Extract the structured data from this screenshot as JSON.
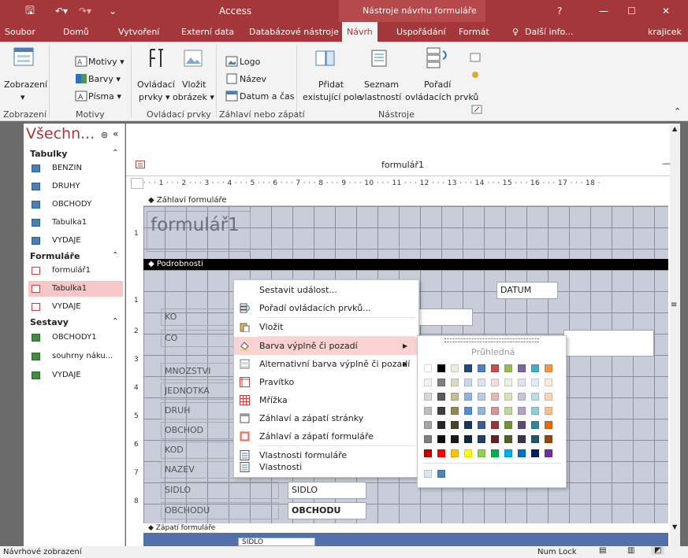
{
  "app": {
    "title": "Access",
    "context_title": "Nástroje návrhu formuláře",
    "help": "?",
    "minimize": "—",
    "maximize": "☐",
    "close": "✕"
  },
  "menu": {
    "tabs": [
      "Soubor",
      "Domů",
      "Vytvoření",
      "Externí data",
      "Databázové nástroje",
      "Návrh",
      "Uspořádání",
      "Formát"
    ],
    "tell_me": "Další info...",
    "user": "krajicek"
  },
  "ribbon": {
    "zobrazeni": "Zobrazení",
    "motivy": "Motivy",
    "barvy": "Barvy",
    "pisma": "Písma",
    "ovladaci": "Ovládací",
    "prvky": "prvky",
    "vlozit": "Vložit",
    "obrazek": "obrázek",
    "logo": "Logo",
    "nazev": "Název",
    "datum_cas": "Datum a čas",
    "pridat": "Přidat",
    "existujici_pole": "existující pole",
    "seznam": "Seznam",
    "vlastnosti": "vlastností",
    "poradi": "Pořadí",
    "ovladacich_prvku": "ovládacích prvků",
    "groups": {
      "zobrazeni": "Zobrazení",
      "motivy": "Motivy",
      "ovladaci_prvky": "Ovládací prvky",
      "zahlavi": "Záhlaví nebo zápatí",
      "nastroje": "Nástroje"
    }
  },
  "nav": {
    "title": "Všechn...",
    "groups": [
      {
        "name": "Tabulky",
        "items": [
          "BENZIN",
          "DRUHY",
          "OBCHODY",
          "Tabulka1",
          "VYDAJE"
        ]
      },
      {
        "name": "Formuláře",
        "items": [
          "formulář1",
          "Tabulka1",
          "VYDAJE"
        ]
      },
      {
        "name": "Sestavy",
        "items": [
          "OBCHODY1",
          "souhrny náku...",
          "VYDAJE"
        ]
      }
    ],
    "selected": "Tabulka1"
  },
  "form": {
    "window_title": "formulář1",
    "header_section": "Záhlaví formuláře",
    "detail_section": "Podrobnosti",
    "footer_section": "Zápatí formuláře",
    "header_label": "formulář1",
    "ruler_top": [
      "1",
      "2",
      "3",
      "4",
      "5",
      "6",
      "7",
      "8",
      "9",
      "10",
      "11",
      "12",
      "13",
      "14",
      "15",
      "16",
      "17",
      "18"
    ],
    "ruler_left": [
      "1",
      "1",
      "2",
      "3",
      "4",
      "5",
      "6",
      "7",
      "8"
    ],
    "labels": [
      "KO",
      "CO",
      "MNOZSTVI",
      "JEDNOTKA",
      "DRUH",
      "OBCHOD",
      "KOD",
      "NAZEV",
      "SIDLO",
      "OBCHODU"
    ],
    "fields": {
      "datum": "DATUM",
      "sidlo": "SIDLO",
      "obchodu": "OBCHODU",
      "footer_sidlo": "SIDLO"
    }
  },
  "context_menu": {
    "items": [
      "Sestavit událost...",
      "Pořadí ovládacích prvků...",
      "Vložit",
      "Barva výplně či pozadí",
      "Alternativní barva výplně či pozadí",
      "Pravítko",
      "Mřížka",
      "Záhlaví a zápatí stránky",
      "Záhlaví a zápatí formuláře",
      "Vlastnosti formuláře",
      "Vlastnosti"
    ],
    "highlighted": "Barva výplně či pozadí"
  },
  "palette": {
    "transparent_label": "Průhledná",
    "rows": [
      [
        "#ffffff",
        "#000000",
        "#eeece1",
        "#1f497d",
        "#4f81bd",
        "#c0504d",
        "#9bbb59",
        "#8064a2",
        "#4bacc6",
        "#f79646"
      ],
      [
        "#f2f2f2",
        "#7f7f7f",
        "#ddd9c3",
        "#c6d9f0",
        "#dbe5f1",
        "#f2dcdb",
        "#ebf1dd",
        "#e5e0ec",
        "#dbeef3",
        "#fdeada"
      ],
      [
        "#d8d8d8",
        "#595959",
        "#c4bd97",
        "#8db3e2",
        "#b8cce4",
        "#e5b9b7",
        "#d7e3bc",
        "#ccc1d9",
        "#b7dde8",
        "#fbd5b5"
      ],
      [
        "#bfbfbf",
        "#3f3f3f",
        "#938953",
        "#548dd4",
        "#95b3d7",
        "#d99694",
        "#c3d69b",
        "#b2a2c7",
        "#92cddc",
        "#fac08f"
      ],
      [
        "#a5a5a5",
        "#262626",
        "#494429",
        "#17365d",
        "#366092",
        "#953734",
        "#76923c",
        "#5f497a",
        "#31859b",
        "#e36c09"
      ],
      [
        "#7f7f7f",
        "#0c0c0c",
        "#1d1b10",
        "#0f243e",
        "#244061",
        "#632423",
        "#4f6128",
        "#3f3151",
        "#205867",
        "#974806"
      ],
      [
        "#c00000",
        "#ff0000",
        "#ffc000",
        "#ffff00",
        "#92d050",
        "#00b050",
        "#00b0f0",
        "#0070c0",
        "#002060",
        "#7030a0"
      ]
    ],
    "recent": [
      "#dbe5f1",
      "#4f81bd"
    ]
  },
  "status": {
    "left": "Návrhové zobrazení",
    "numlock": "Num Lock"
  }
}
